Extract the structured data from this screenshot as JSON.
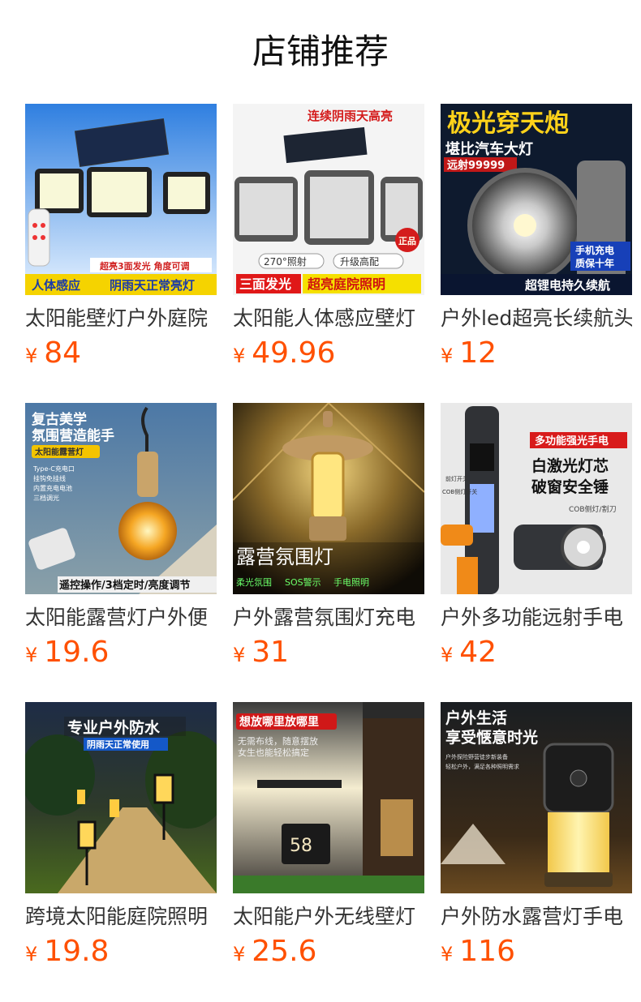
{
  "page": {
    "title": "店铺推荐"
  },
  "colors": {
    "price": "#ff5000",
    "title": "#111111",
    "name": "#333333"
  },
  "products": [
    {
      "name": "太阳能壁灯户外庭院",
      "currency": "¥",
      "price": "84",
      "image_texts": [
        "超亮3面发光  角度可调",
        "人体感应",
        "阴雨天正常亮灯"
      ]
    },
    {
      "name": "太阳能人体感应壁灯",
      "currency": "¥",
      "price": "49.96",
      "image_texts": [
        "连续阴雨天高亮",
        "正品",
        "270°照射",
        "升级高配",
        "三面发光",
        "超亮庭院照明"
      ]
    },
    {
      "name": "户外led超亮长续航头",
      "currency": "¥",
      "price": "12",
      "image_texts": [
        "极光穿天炮",
        "堪比汽车大灯",
        "远射99999",
        "手机充电",
        "质保十年",
        "超锂电持久续航"
      ]
    },
    {
      "name": "太阳能露营灯户外便",
      "currency": "¥",
      "price": "19.6",
      "image_texts": [
        "复古美学",
        "氛围营造能手",
        "太阳能露营灯",
        "Type-C充电口",
        "挂钩免挂线",
        "内置充电电池",
        "三档调光",
        "遥控操作/3档定时/亮度调节"
      ]
    },
    {
      "name": "户外露营氛围灯充电",
      "currency": "¥",
      "price": "31",
      "image_texts": [
        "露营氛围灯",
        "柔光氛围",
        "SOS警示",
        "手电照明"
      ]
    },
    {
      "name": "户外多功能远射手电",
      "currency": "¥",
      "price": "42",
      "image_texts": [
        "多功能强光手电",
        "白激光灯芯",
        "破窗安全锤",
        "COB侧灯/割刀",
        "前灯开关",
        "COB侧灯开关"
      ]
    },
    {
      "name": "跨境太阳能庭院照明",
      "currency": "¥",
      "price": "19.8",
      "image_texts": [
        "专业户外防水",
        "阴雨天正常使用"
      ]
    },
    {
      "name": "太阳能户外无线壁灯",
      "currency": "¥",
      "price": "25.6",
      "image_texts": [
        "想放哪里放哪里",
        "无需布线，随意摆放",
        "女生也能轻松搞定",
        "58"
      ]
    },
    {
      "name": "户外防水露营灯手电",
      "currency": "¥",
      "price": "116",
      "image_texts": [
        "户外生活",
        "享受惬意时光",
        "户外探险野营徒步新装备",
        "轻松户外，满足各种照明需求"
      ]
    }
  ]
}
